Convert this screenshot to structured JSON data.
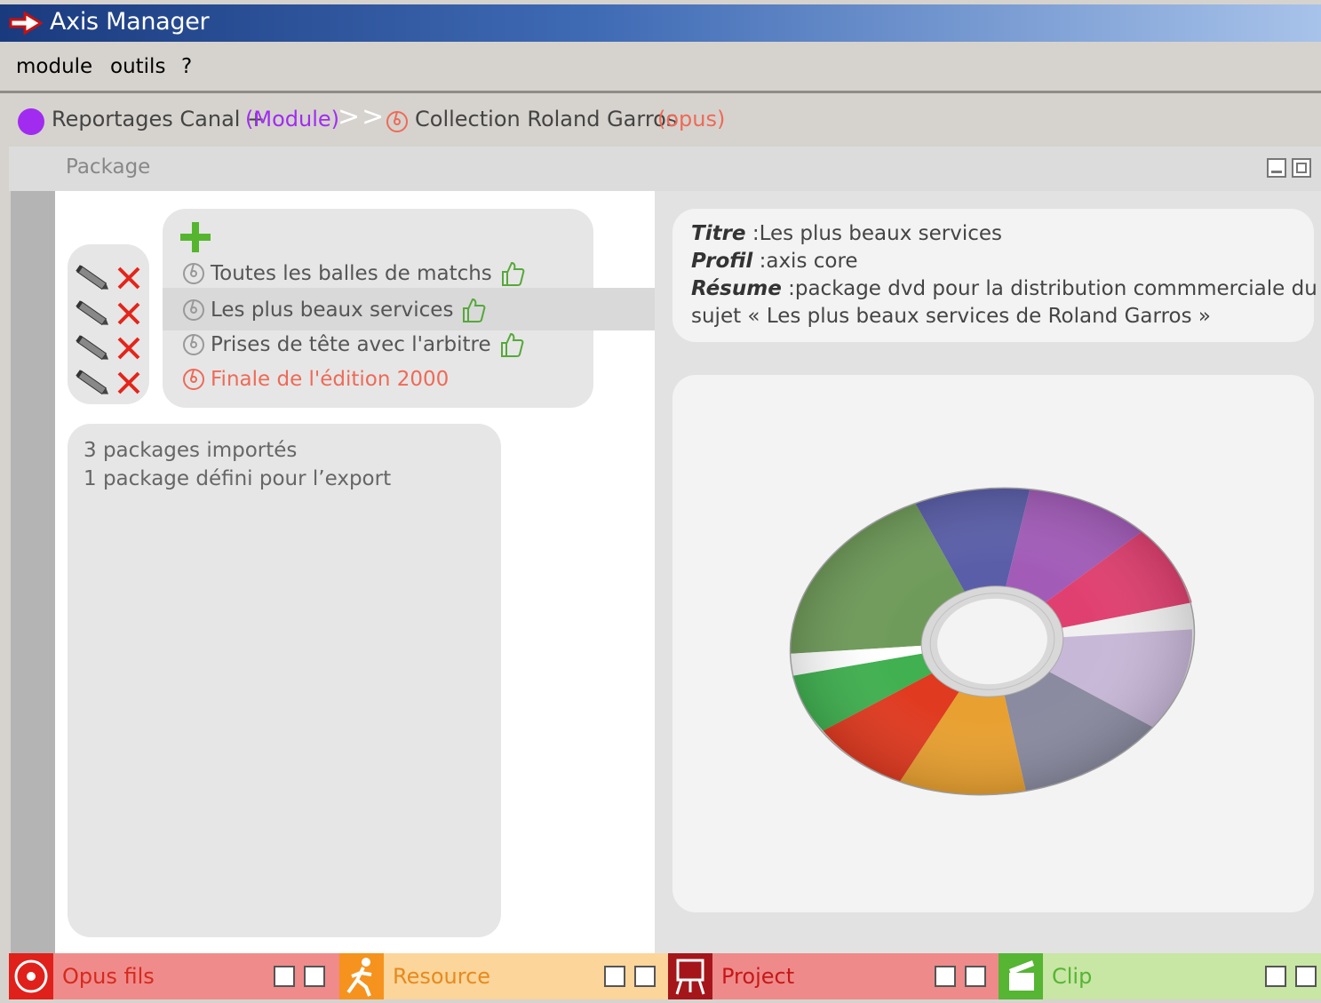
{
  "window": {
    "title": "Axis Manager"
  },
  "menu": {
    "items": [
      "module",
      "outils",
      "?"
    ]
  },
  "breadcrumb": {
    "module_name": "Reportages Canal +",
    "module_tag": "(Module)",
    "separator": ">>",
    "opus_name": "Collection Roland Garros",
    "opus_tag": "(opus)"
  },
  "package": {
    "title": "Package",
    "items": [
      {
        "label": "Toutes les balles de matchs",
        "status": "approved"
      },
      {
        "label": "Les plus beaux services",
        "status": "approved",
        "selected": true
      },
      {
        "label": "Prises de tête avec l'arbitre",
        "status": "approved"
      },
      {
        "label": "Finale de l'édition 2000",
        "status": "pending"
      }
    ],
    "summary": [
      "3 packages importés",
      "1 package défini pour l’export"
    ]
  },
  "details": {
    "titre_label": "Titre",
    "titre_value": "Les plus beaux services",
    "profil_label": "Profil",
    "profil_value": "axis core",
    "resume_label": "Résume",
    "resume_line1": "package dvd pour la distribution commmerciale du",
    "resume_line2": "sujet « Les plus beaux services de Roland Garros »"
  },
  "bottom_tabs": [
    {
      "label": "Opus fils",
      "color": "#f08b8b",
      "icon": "cd-icon"
    },
    {
      "label": "Resource",
      "color": "#fcd59a",
      "icon": "runner-icon"
    },
    {
      "label": "Project",
      "color": "#ef8a8a",
      "icon": "easel-icon"
    },
    {
      "label": "Clip",
      "color": "#c8e6a4",
      "icon": "clapper-icon"
    }
  ],
  "colors": {
    "module_accent": "#a12cf0",
    "opus_accent": "#ee6a57",
    "add_green": "#55b52f",
    "delete_red": "#e3251b"
  }
}
